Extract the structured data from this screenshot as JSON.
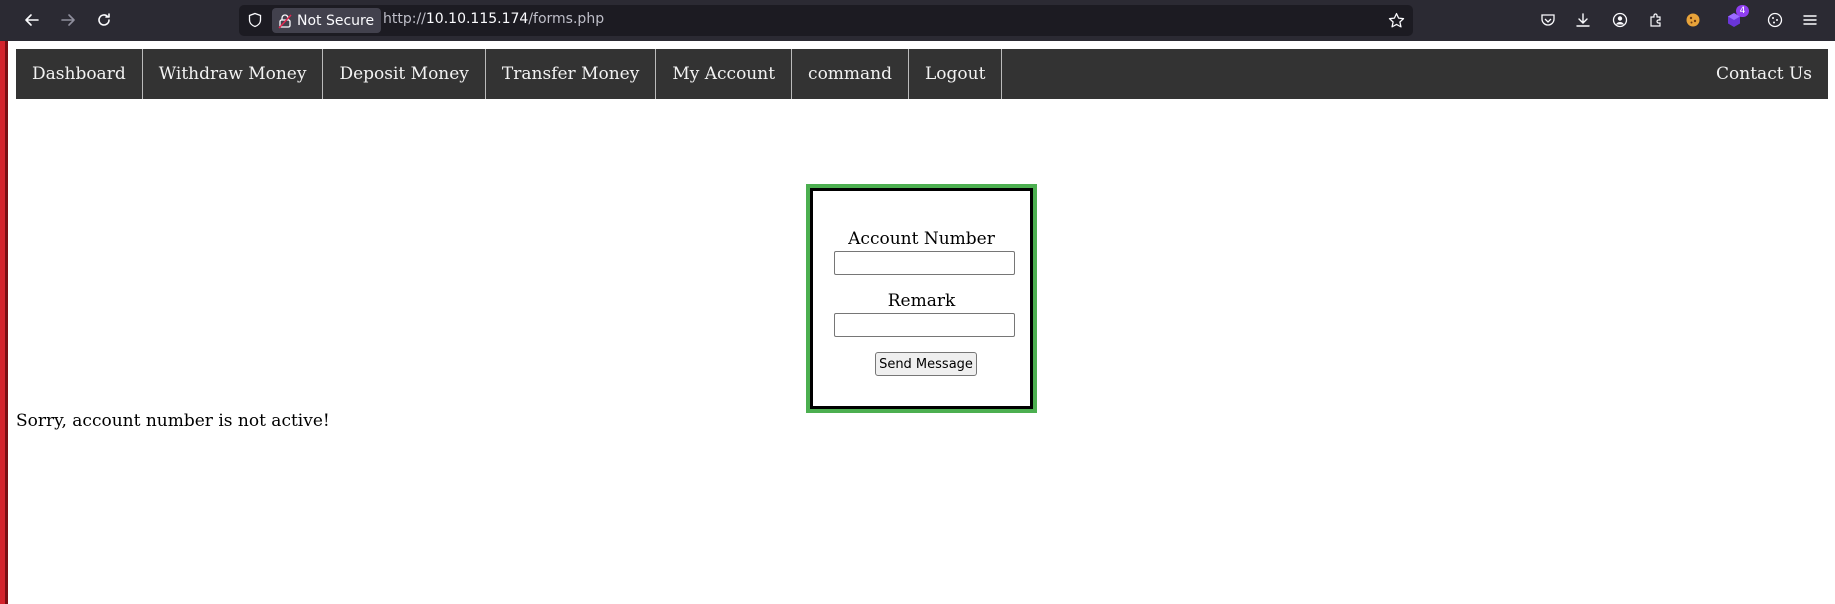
{
  "browser": {
    "security_label": "Not Secure",
    "url_prefix": "http://",
    "url_host": "10.10.115.174",
    "url_path": "/forms.php",
    "extension_badge": "4"
  },
  "nav": {
    "items": [
      {
        "label": "Dashboard"
      },
      {
        "label": "Withdraw Money"
      },
      {
        "label": "Deposit Money"
      },
      {
        "label": "Transfer Money"
      },
      {
        "label": "My Account"
      },
      {
        "label": "command"
      },
      {
        "label": "Logout"
      }
    ],
    "right_item": "Contact Us"
  },
  "form": {
    "account_label": "Account Number",
    "account_value": "",
    "remark_label": "Remark",
    "remark_value": "",
    "submit_label": "Send Message"
  },
  "message": "Sorry, account number is not active!",
  "colors": {
    "nav_bg": "#333333",
    "form_border": "#4caf50",
    "browser_bg": "#2b2a33"
  }
}
